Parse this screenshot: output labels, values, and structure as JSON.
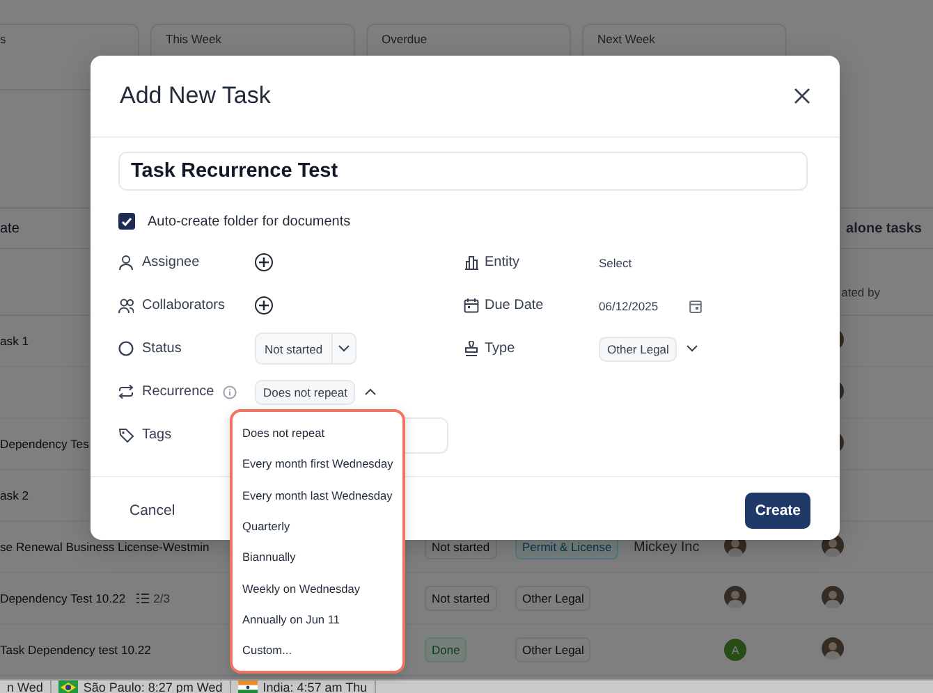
{
  "stat_cards": [
    {
      "label": "s"
    },
    {
      "label": "This Week"
    },
    {
      "label": "Overdue"
    },
    {
      "label": "Next Week"
    }
  ],
  "task_list": {
    "column_header": "ate",
    "section_title": "alone tasks",
    "created_by_header": "ated by",
    "rows": [
      {
        "title": "ask 1",
        "creator": {
          "kind": "photo"
        }
      },
      {
        "creator": {
          "kind": "photo"
        }
      },
      {
        "title": "Dependency Tes",
        "creator": {
          "kind": "photo"
        }
      },
      {
        "title": "ask 2"
      },
      {
        "title": "se Renewal Business License-Westmin",
        "status": {
          "label": "Not started",
          "kind": "not-started"
        },
        "type": {
          "label": "Permit & License",
          "kind": "permit"
        },
        "entity": "Mickey Inc",
        "assignee": {
          "kind": "photo"
        },
        "creator": {
          "kind": "photo"
        }
      },
      {
        "title": "Dependency Test 10.22",
        "checklist": "2/3",
        "status": {
          "label": "Not started",
          "kind": "not-started"
        },
        "type": {
          "label": "Other Legal",
          "kind": "other"
        },
        "assignee": {
          "kind": "photo"
        },
        "creator": {
          "kind": "photo"
        }
      },
      {
        "title": "Task Dependency test 10.22",
        "status": {
          "label": "Done",
          "kind": "done"
        },
        "type": {
          "label": "Other Legal",
          "kind": "other"
        },
        "assignee": {
          "kind": "initial",
          "initial": "A"
        },
        "creator": {
          "kind": "photo"
        }
      }
    ]
  },
  "status_bar": [
    {
      "text": "n Wed"
    },
    {
      "text": "São Paulo: 8:27 pm Wed"
    },
    {
      "text": "India: 4:57 am Thu"
    }
  ],
  "dialog": {
    "title": "Add New Task",
    "task_name": "Task Recurrence Test",
    "auto_folder": {
      "label": "Auto-create folder for documents",
      "checked": true
    },
    "left_fields": [
      {
        "label": "Assignee",
        "kind": "add"
      },
      {
        "label": "Collaborators",
        "kind": "add"
      },
      {
        "label": "Status",
        "kind": "split-select",
        "value": "Not started"
      },
      {
        "label": "Recurrence",
        "kind": "select",
        "value": "Does not repeat",
        "info": true,
        "expanded": true
      },
      {
        "label": "Tags",
        "kind": "tag-input"
      }
    ],
    "right_fields": [
      {
        "label": "Entity",
        "kind": "text",
        "value": "Select"
      },
      {
        "label": "Due Date",
        "kind": "date",
        "value": "06/12/2025"
      },
      {
        "label": "Type",
        "kind": "select",
        "value": "Other Legal",
        "expanded": false
      }
    ],
    "cancel": "Cancel",
    "create": "Create",
    "recurrence_menu": {
      "options": [
        {
          "label": "Does not repeat",
          "selected": false
        },
        {
          "label": "Every month first Wednesday",
          "selected": false
        },
        {
          "label": "Every month last Wednesday",
          "selected": false
        },
        {
          "label": "Quarterly",
          "selected": false
        },
        {
          "label": "Biannually",
          "selected": false
        },
        {
          "label": "Weekly on Wednesday",
          "selected": false
        },
        {
          "label": "Annually on Jun 11",
          "selected": false
        },
        {
          "label": "Custom...",
          "selected": false
        }
      ]
    }
  }
}
